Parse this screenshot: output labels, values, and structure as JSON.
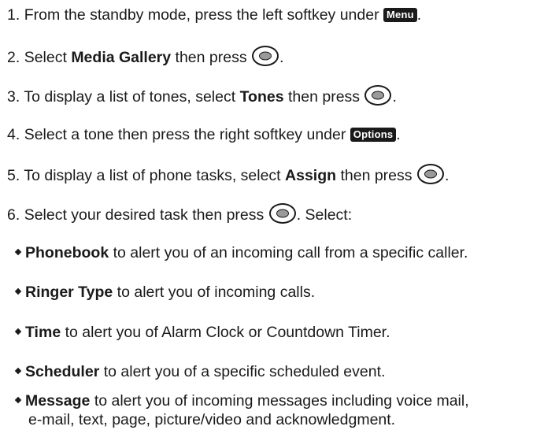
{
  "steps": [
    {
      "num": "1.",
      "pre": "From the standby mode, press the left softkey under",
      "key": "Menu",
      "post": "."
    },
    {
      "num": "2.",
      "pre": "Select",
      "bold": "Media Gallery",
      "mid": "then press",
      "post": "."
    },
    {
      "num": "3.",
      "pre": "To display a list of tones, select",
      "bold": "Tones",
      "mid": "then press",
      "post": "."
    },
    {
      "num": "4.",
      "pre": "Select a tone then press the right softkey under",
      "key": "Options",
      "post": "."
    },
    {
      "num": "5.",
      "pre": "To display a list of phone tasks, select",
      "bold": "Assign",
      "mid": "then press",
      "post": "."
    },
    {
      "num": "6.",
      "pre": "Select your desired task then press",
      "post": ". Select:"
    }
  ],
  "options": [
    {
      "bold": "Phonebook",
      "text": "to alert you of an incoming call from a specific caller."
    },
    {
      "bold": "Ringer Type",
      "text": "to alert you of incoming calls."
    },
    {
      "bold": "Time",
      "text": "to alert you of Alarm Clock or Countdown Timer."
    },
    {
      "bold": "Scheduler",
      "text": "to alert you of a specific scheduled event."
    },
    {
      "bold": "Message",
      "text": "to alert you of incoming messages including voice mail,",
      "text2": "e-mail, text, page, picture/video and acknowledgment."
    }
  ],
  "icons": {
    "ok_key": "ok-key-icon",
    "bullet": "diamond-bullet-icon"
  }
}
